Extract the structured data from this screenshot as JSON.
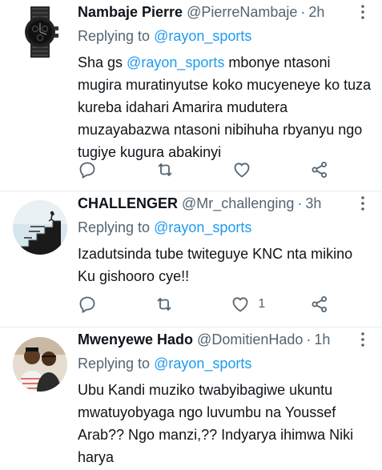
{
  "tweets": [
    {
      "name": "Nambaje Pierre",
      "handle": "@PierreNambaje",
      "separator": "·",
      "time": "2h",
      "replying_prefix": "Replying to",
      "replying_to": "@rayon_sports",
      "text_prefix": "Sha gs ",
      "text_mention": "@rayon_sports",
      "text_body": " mbonye ntasoni mugira muratinyutse koko mucyeneye ko tuza kureba idahari Amarira mudutera muzayabazwa ntasoni nibihuha rbyanyu ngo tugiye kugura abakinyi",
      "like_count": "",
      "avatar": "wristwatch-avatar"
    },
    {
      "name": "CHALLENGER",
      "handle": "@Mr_challenging",
      "separator": "·",
      "time": "3h",
      "replying_prefix": "Replying to",
      "replying_to": "@rayon_sports",
      "text": "Izadutsinda tube twiteguye KNC nta mikino Ku gishooro cye!!",
      "like_count": "1",
      "avatar": "staircase-avatar"
    },
    {
      "name": "Mwenyewe Hado",
      "handle": "@DomitienHado",
      "separator": "·",
      "time": "1h",
      "replying_prefix": "Replying to",
      "replying_to": "@rayon_sports",
      "text": "Ubu Kandi muziko twabyibagiwe ukuntu mwatuyobyaga ngo luvumbu na Youssef Arab?? Ngo manzi,?? Indyarya ihimwa Niki harya",
      "like_count": "",
      "avatar": "two-people-avatar"
    }
  ],
  "colors": {
    "link": "#1d9bf0",
    "secondary_text": "#536471",
    "primary_text": "#0f1419",
    "divider": "#e6ecf0"
  }
}
